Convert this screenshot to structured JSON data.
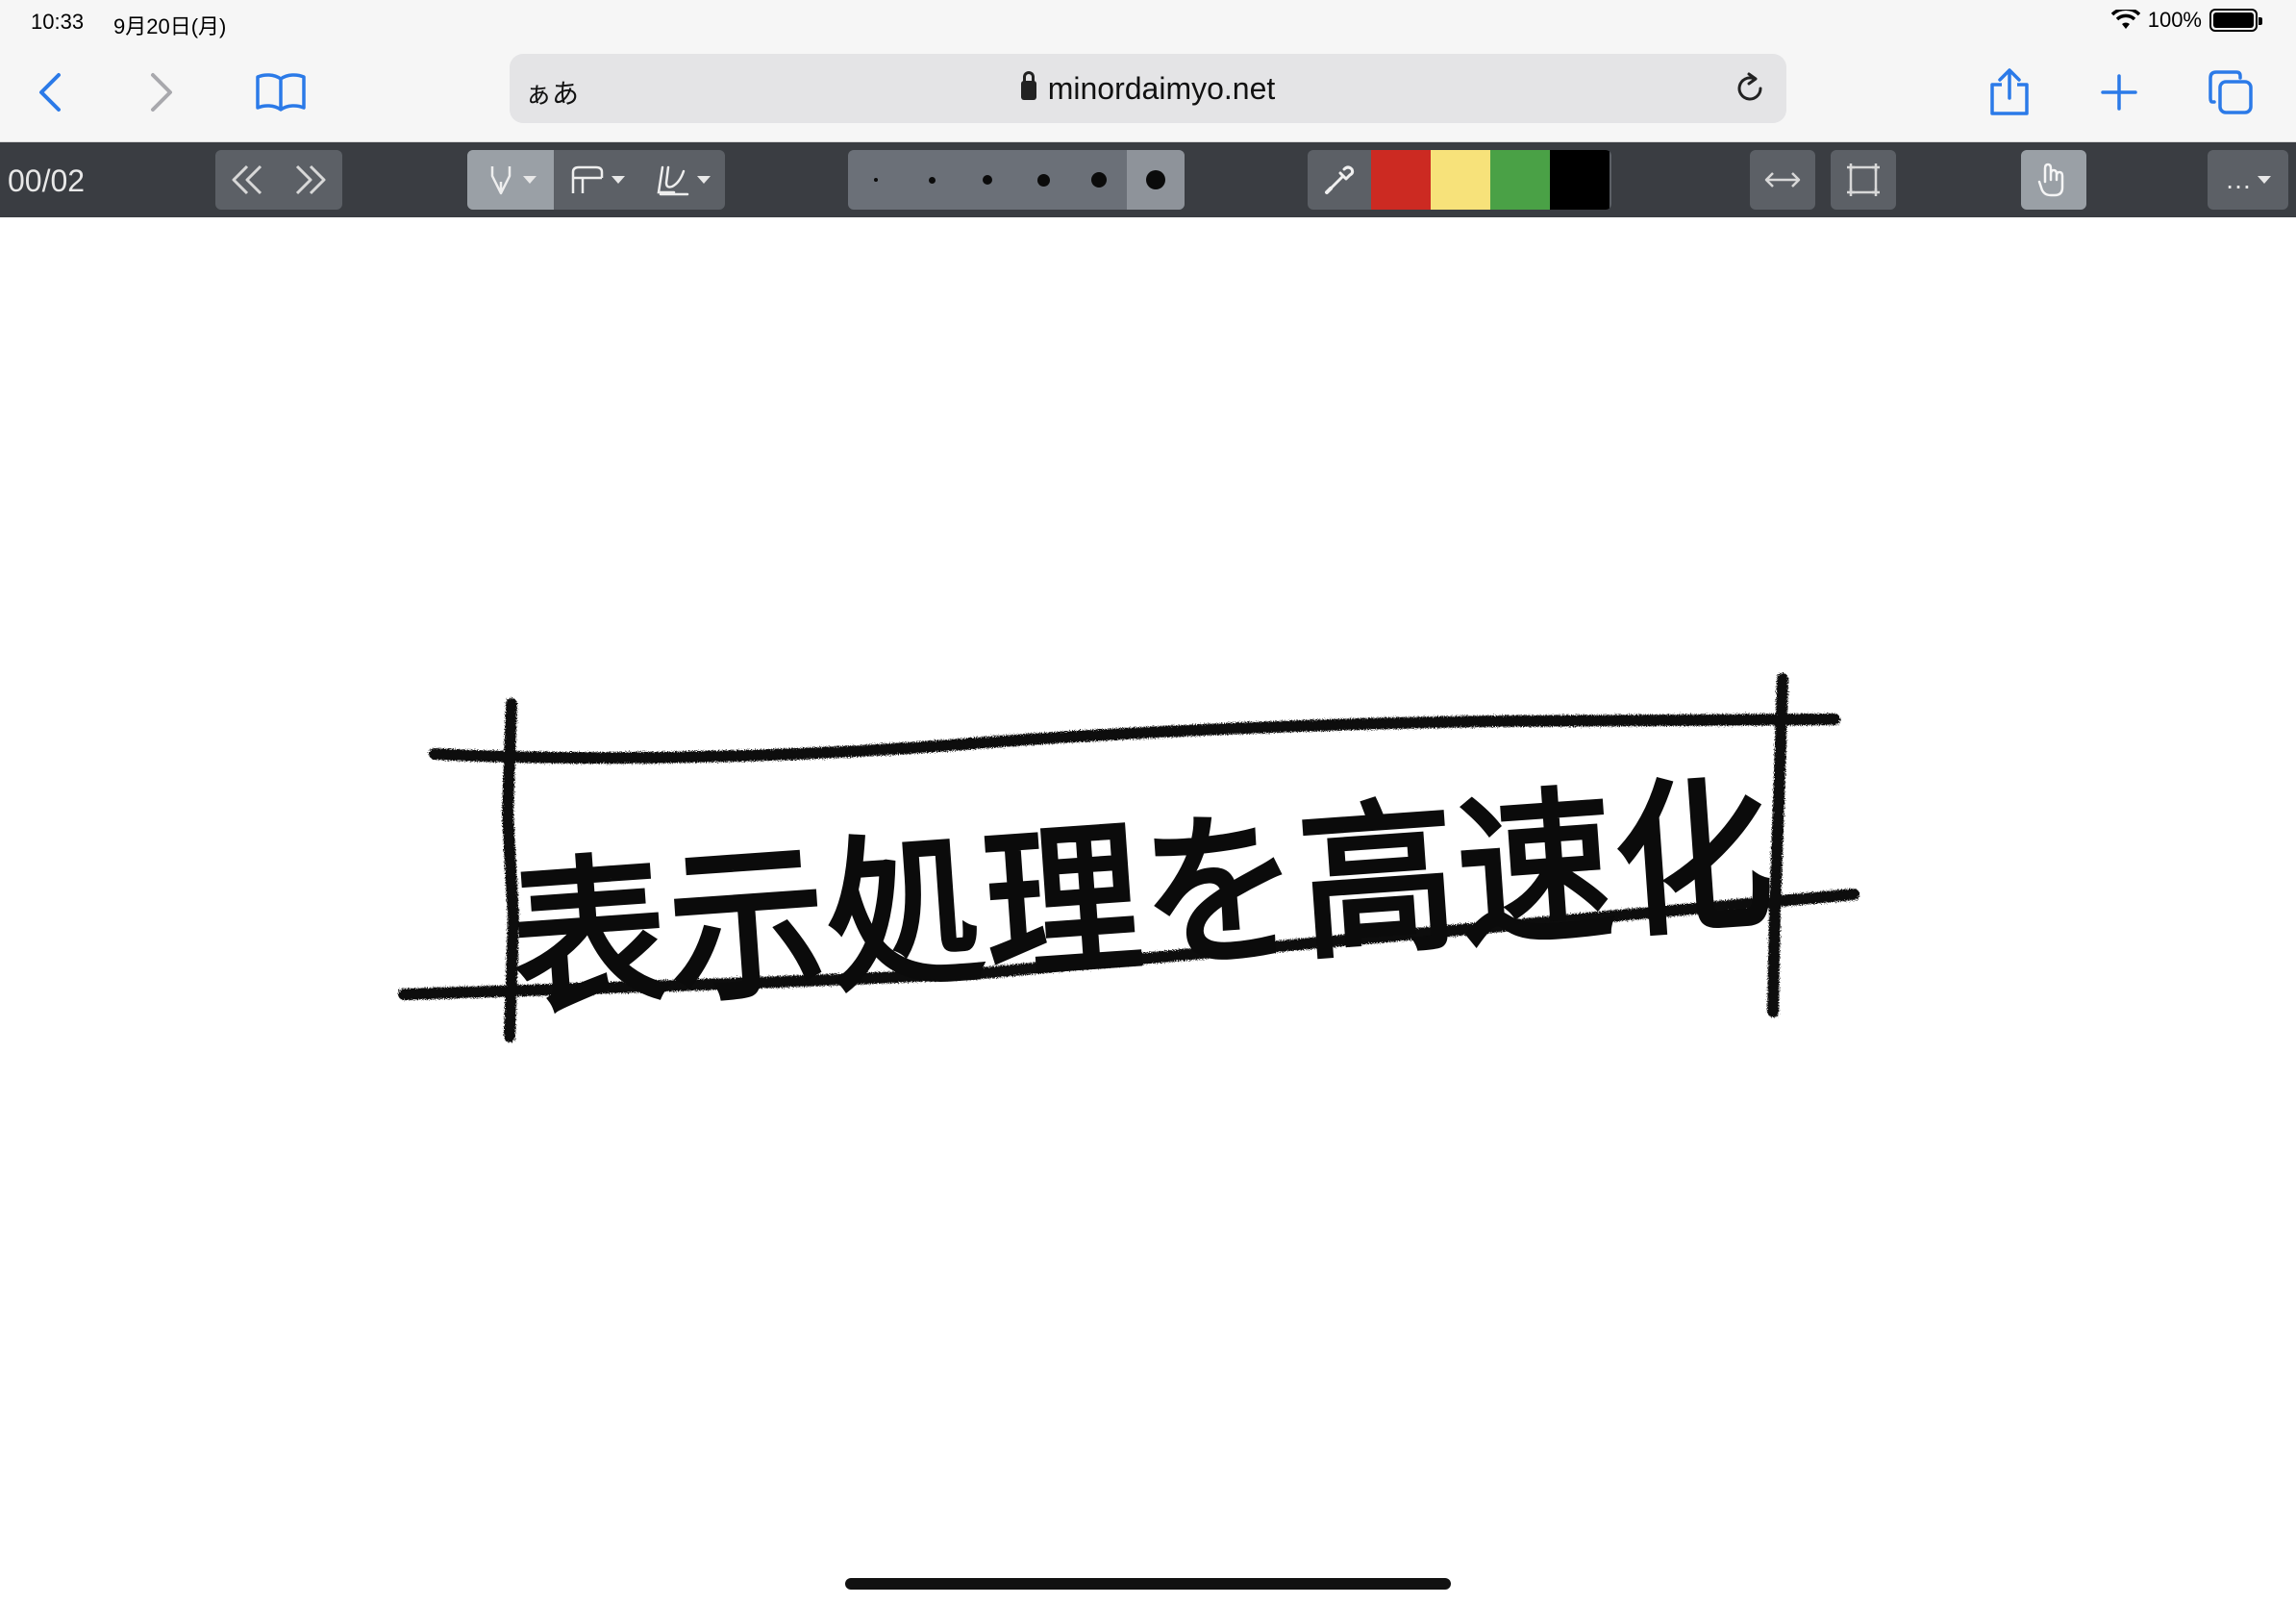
{
  "status_bar": {
    "time": "10:33",
    "date": "9月20日(月)",
    "battery": "100%"
  },
  "browser": {
    "aa_label": "ぁあ",
    "url": "minordaimyo.net",
    "back_icon": "chevron-left-icon",
    "forward_icon": "chevron-right-icon",
    "bookmarks_icon": "book-icon",
    "share_icon": "share-icon",
    "new_tab_icon": "plus-icon",
    "tabs_icon": "tabs-icon",
    "accent_color": "#2b7ae8"
  },
  "toolbar": {
    "page_counter": "00/02",
    "more_label": "…",
    "colors": [
      "#cc2a22",
      "#f7e27a",
      "#4aa146",
      "#000000"
    ]
  },
  "canvas": {
    "handwritten_text": "表示処理を高速化"
  }
}
